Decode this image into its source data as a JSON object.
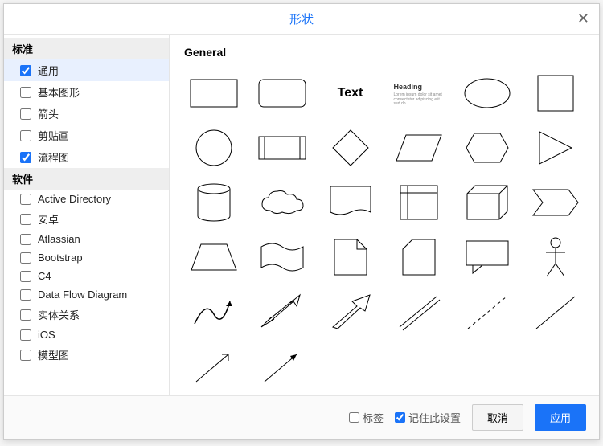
{
  "dialog": {
    "title": "形状"
  },
  "sidebar": {
    "groups": [
      {
        "header": "标准",
        "items": [
          {
            "label": "通用",
            "checked": true,
            "selected": true
          },
          {
            "label": "基本图形",
            "checked": false
          },
          {
            "label": "箭头",
            "checked": false
          },
          {
            "label": "剪贴画",
            "checked": false
          },
          {
            "label": "流程图",
            "checked": true
          }
        ]
      },
      {
        "header": "软件",
        "items": [
          {
            "label": "Active Directory",
            "checked": false
          },
          {
            "label": "安卓",
            "checked": false
          },
          {
            "label": "Atlassian",
            "checked": false
          },
          {
            "label": "Bootstrap",
            "checked": false
          },
          {
            "label": "C4",
            "checked": false
          },
          {
            "label": "Data Flow Diagram",
            "checked": false
          },
          {
            "label": "实体关系",
            "checked": false
          },
          {
            "label": "iOS",
            "checked": false
          },
          {
            "label": "模型图",
            "checked": false
          }
        ]
      }
    ]
  },
  "main": {
    "section_title": "General",
    "text_label": "Text",
    "heading_label": "Heading"
  },
  "footer": {
    "labels_check": "标签",
    "remember_check": "记住此设置",
    "remember_checked": true,
    "cancel": "取消",
    "apply": "应用"
  }
}
